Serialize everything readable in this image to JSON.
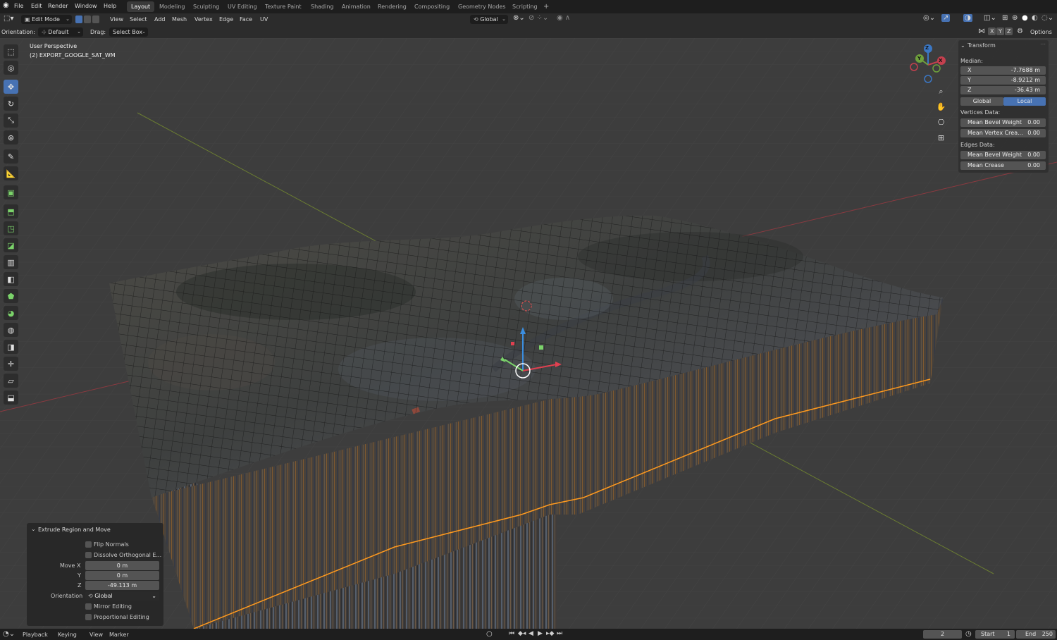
{
  "menubar": {
    "items": [
      "File",
      "Edit",
      "Render",
      "Window",
      "Help"
    ],
    "workspaces": [
      "Layout",
      "Modeling",
      "Sculpting",
      "UV Editing",
      "Texture Paint",
      "Shading",
      "Animation",
      "Rendering",
      "Compositing",
      "Geometry Nodes",
      "Scripting"
    ],
    "add_workspace": "+"
  },
  "header": {
    "mode": "Edit Mode",
    "menus": [
      "View",
      "Select",
      "Add",
      "Mesh",
      "Vertex",
      "Edge",
      "Face",
      "UV"
    ],
    "transform_orientation": "Global"
  },
  "toolsettings": {
    "orientation_label": "Orientation:",
    "orientation_value": "Default",
    "drag_label": "Drag:",
    "drag_value": "Select Box",
    "axes": [
      "X",
      "Y",
      "Z"
    ],
    "options": "Options"
  },
  "viewport": {
    "perspective": "User Perspective",
    "object": "(2) EXPORT_GOOGLE_SAT_WM",
    "gizmo_axes": {
      "x": "X",
      "y": "Y",
      "z": "Z"
    },
    "colors": {
      "x_axis": "#c4404e",
      "y_axis": "#6fa13c",
      "z_axis": "#3b77c4",
      "select_orange": "#ff9a1f"
    }
  },
  "npanel": {
    "title": "Transform",
    "median_label": "Median:",
    "x": {
      "label": "X",
      "value": "-7.7688 m"
    },
    "y": {
      "label": "Y",
      "value": "-8.9212 m"
    },
    "z": {
      "label": "Z",
      "value": "-36.43 m"
    },
    "toggle_global": "Global",
    "toggle_local": "Local",
    "vertices_label": "Vertices Data:",
    "mean_bevel_weight_v": {
      "label": "Mean Bevel Weight",
      "value": "0.00"
    },
    "mean_vertex_crease": {
      "label": "Mean Vertex Crea...",
      "value": "0.00"
    },
    "edges_label": "Edges Data:",
    "mean_bevel_weight_e": {
      "label": "Mean Bevel Weight",
      "value": "0.00"
    },
    "mean_crease": {
      "label": "Mean Crease",
      "value": "0.00"
    }
  },
  "redo_panel": {
    "title": "Extrude Region and Move",
    "flip_normals": "Flip Normals",
    "dissolve": "Dissolve Orthogonal E...",
    "move_x_label": "Move X",
    "move_x": "0 m",
    "y_label": "Y",
    "move_y": "0 m",
    "z_label": "Z",
    "move_z": "-49.113 m",
    "orientation_label": "Orientation",
    "orientation_value": "Global",
    "mirror_editing": "Mirror Editing",
    "proportional_editing": "Proportional Editing"
  },
  "timeline": {
    "menus": [
      "Playback",
      "Keying",
      "View",
      "Marker"
    ],
    "current_frame": "2",
    "start_label": "Start",
    "start_value": "1",
    "end_label": "End",
    "end_value": "250"
  }
}
